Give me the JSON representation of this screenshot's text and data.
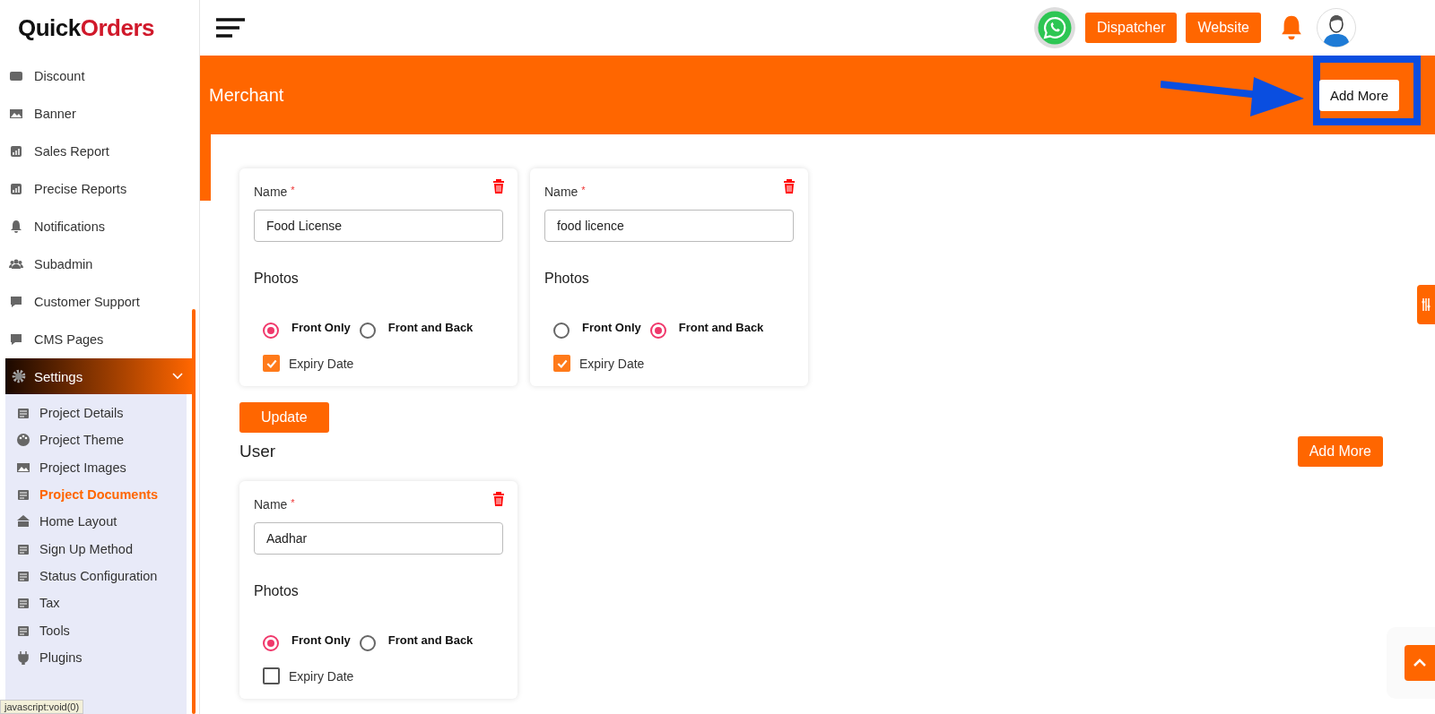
{
  "logo": {
    "part_1": "Quick",
    "part_2": "Orders"
  },
  "sidebar": {
    "items": [
      {
        "label": "Discount"
      },
      {
        "label": "Banner"
      },
      {
        "label": "Sales Report"
      },
      {
        "label": "Precise Reports"
      },
      {
        "label": "Notifications"
      },
      {
        "label": "Subadmin"
      },
      {
        "label": "Customer Support"
      },
      {
        "label": "CMS Pages"
      }
    ],
    "settings": {
      "label": "Settings",
      "expanded": true,
      "children": [
        {
          "label": "Project Details",
          "selected": false
        },
        {
          "label": "Project Theme",
          "selected": false
        },
        {
          "label": "Project Images",
          "selected": false
        },
        {
          "label": "Project Documents",
          "selected": true
        },
        {
          "label": "Home Layout",
          "selected": false
        },
        {
          "label": "Sign Up Method",
          "selected": false
        },
        {
          "label": "Status Configuration",
          "selected": false
        },
        {
          "label": "Tax",
          "selected": false
        },
        {
          "label": "Tools",
          "selected": false
        },
        {
          "label": "Plugins",
          "selected": false
        }
      ]
    }
  },
  "topbar": {
    "buttons": [
      "Dispatcher",
      "Website"
    ]
  },
  "sections": [
    {
      "title": "Merchant",
      "add_more": "Add More",
      "update": "Update",
      "cards": [
        {
          "name_label": "Name",
          "required_mark": "*",
          "value": "Food License",
          "photos_label": "Photos",
          "options": [
            {
              "label": "Front Only",
              "selected": true
            },
            {
              "label": "Front and Back",
              "selected": false
            }
          ],
          "expiry": {
            "label": "Expiry Date",
            "checked": true
          }
        },
        {
          "name_label": "Name",
          "required_mark": "*",
          "value": "food licence",
          "photos_label": "Photos",
          "options": [
            {
              "label": "Front Only",
              "selected": false
            },
            {
              "label": "Front and Back",
              "selected": true
            }
          ],
          "expiry": {
            "label": "Expiry Date",
            "checked": true
          }
        }
      ]
    },
    {
      "title": "User",
      "add_more": "Add More",
      "cards": [
        {
          "name_label": "Name",
          "required_mark": "*",
          "value": "Aadhar",
          "photos_label": "Photos",
          "options": [
            {
              "label": "Front Only",
              "selected": true
            },
            {
              "label": "Front and Back",
              "selected": false
            }
          ],
          "expiry": {
            "label": "Expiry Date",
            "checked": false
          }
        }
      ]
    }
  ],
  "status_bar": "javascript:void(0)"
}
